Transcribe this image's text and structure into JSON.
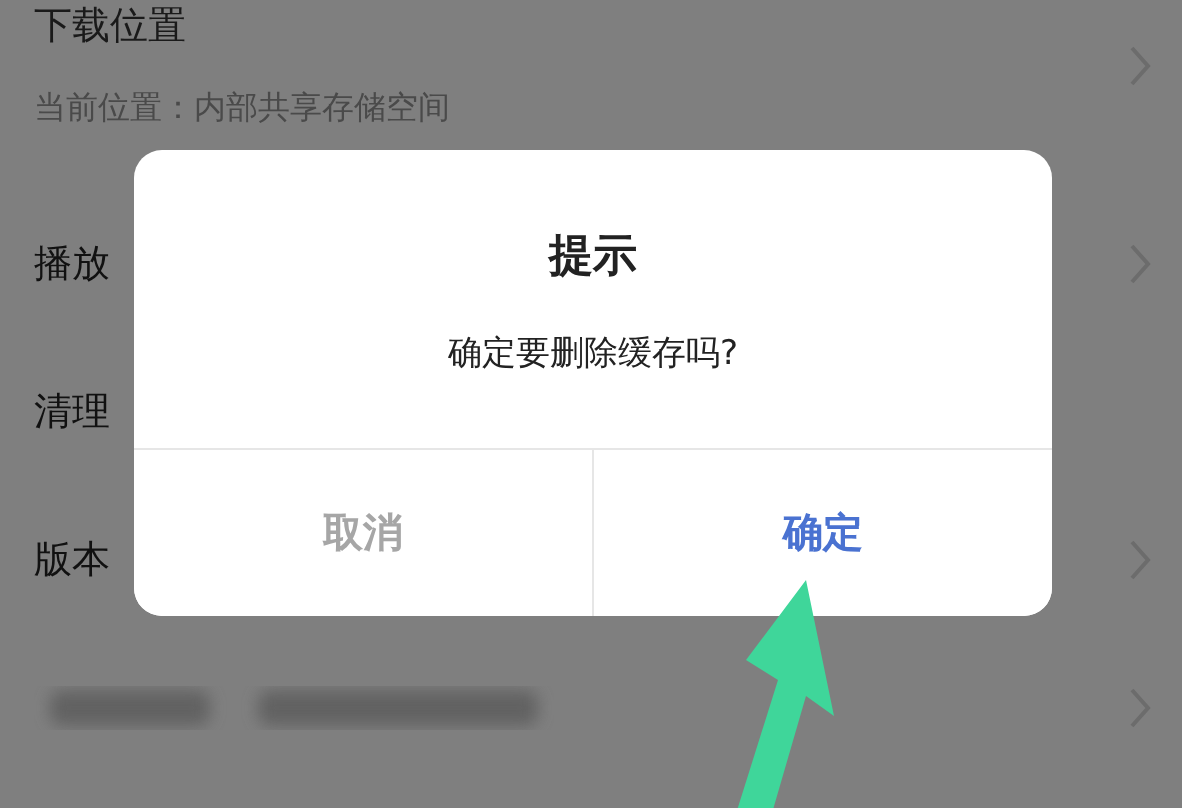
{
  "settings": [
    {
      "kind": "detail",
      "title": "下载位置",
      "subtitle": "当前位置：内部共享存储空间",
      "chevron": true
    },
    {
      "kind": "plain",
      "title": "播放",
      "chevron": true
    },
    {
      "kind": "plain",
      "title": "清理",
      "chevron": false
    },
    {
      "kind": "plain",
      "title": "版本",
      "chevron": true
    },
    {
      "kind": "blurred",
      "chevron": true
    }
  ],
  "dialog": {
    "title": "提示",
    "message": "确定要删除缓存吗?",
    "buttons": [
      {
        "label": "取消",
        "primary": false
      },
      {
        "label": "确定",
        "primary": true
      }
    ]
  }
}
